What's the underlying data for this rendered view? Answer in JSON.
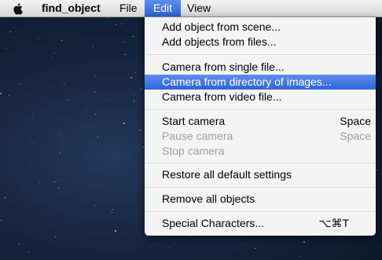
{
  "menubar": {
    "app_name": "find_object",
    "menus": [
      "File",
      "Edit",
      "View"
    ]
  },
  "edit_menu": {
    "add_from_scene": "Add object from scene...",
    "add_from_files": "Add objects from files...",
    "camera_single_file": "Camera from single file...",
    "camera_directory": "Camera from directory of images...",
    "camera_video": "Camera from video file...",
    "start_camera": "Start camera",
    "start_camera_shortcut": "Space",
    "pause_camera": "Pause camera",
    "pause_camera_shortcut": "Space",
    "stop_camera": "Stop camera",
    "restore_defaults": "Restore all default settings",
    "remove_all": "Remove all objects",
    "special_characters": "Special Characters...",
    "special_characters_shortcut": "⌥⌘T"
  },
  "colors": {
    "highlight": "#3a6fe0",
    "disabled_text": "#9f9f9f"
  }
}
